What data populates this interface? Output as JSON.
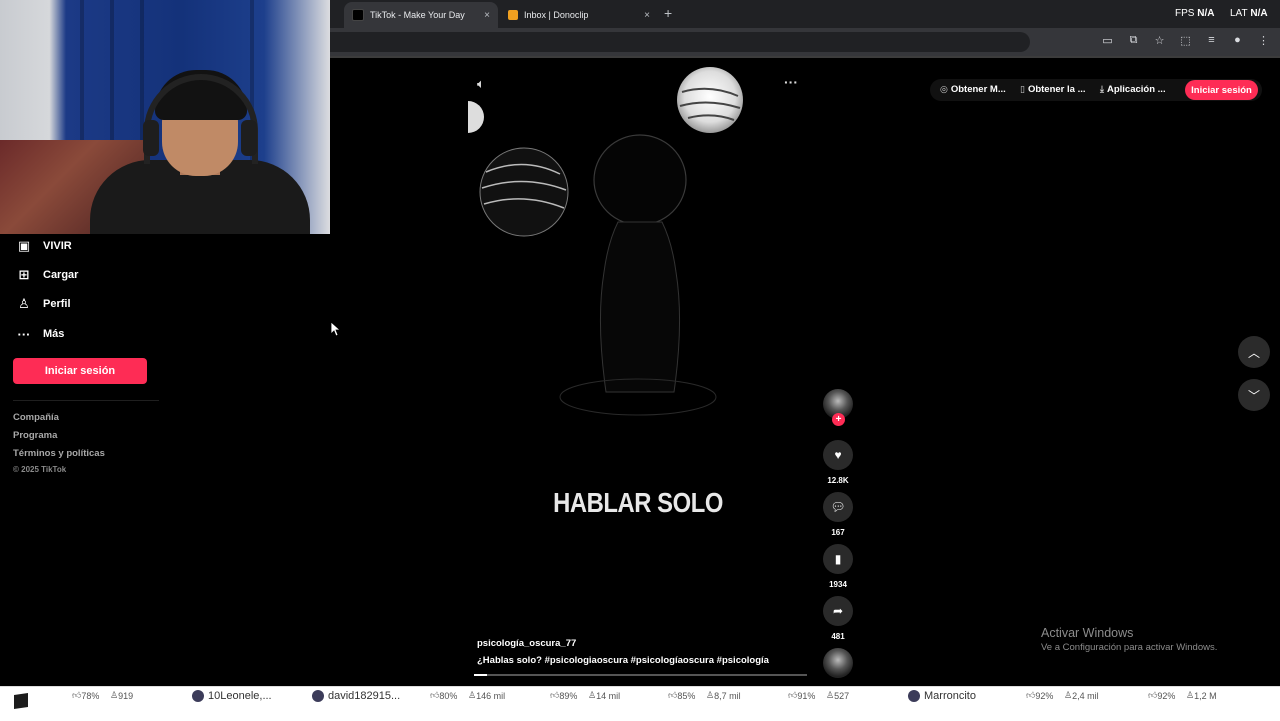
{
  "browser": {
    "tabs": [
      {
        "title": "TikTok - Make Your Day",
        "active": true
      },
      {
        "title": "Inbox | Donoclip",
        "active": false
      }
    ],
    "new_tab": "+",
    "tab_close": "×",
    "osd": {
      "fps_label": "FPS",
      "fps_value": "N/A",
      "lat_label": "LAT",
      "lat_value": "N/A"
    }
  },
  "sidebar": {
    "items": [
      {
        "label": "VIVIR",
        "icon": "live-icon"
      },
      {
        "label": "Cargar",
        "icon": "upload-icon"
      },
      {
        "label": "Perfil",
        "icon": "profile-icon"
      },
      {
        "label": "Más",
        "icon": "more-icon"
      }
    ],
    "login_label": "Iniciar sesión",
    "footer_links": [
      "Compañía",
      "Programa",
      "Términos y políticas"
    ],
    "copyright": "© 2025 TikTok"
  },
  "header": {
    "items": [
      {
        "label": "Obtener M...",
        "icon": "coin-icon"
      },
      {
        "label": "Obtener la ...",
        "icon": "phone-icon"
      },
      {
        "label": "Aplicación ...",
        "icon": "download-icon"
      }
    ],
    "login_label": "Iniciar sesión"
  },
  "video": {
    "title": "HABLAR SOLO",
    "username": "psicología_oscura_77",
    "description": "¿Hablas solo? #psicologiaoscura  #psicologíaoscura  #psicología",
    "progress": 0.04,
    "actions": {
      "likes": "12.8K",
      "comments": "167",
      "saves": "1934",
      "shares": "481"
    }
  },
  "watermark": {
    "line1": "Activar Windows",
    "line2": "Ve a Configuración para activar Windows."
  },
  "taskbar": {
    "items": [
      "78%",
      "919",
      "10Leonele,...",
      "david182915...",
      "80%",
      "146 mil",
      "89%",
      "14 mil",
      "85%",
      "8,7 mil",
      "91%",
      "527",
      "Marroncito",
      "92%",
      "2,4 mil",
      "92%",
      "1,2 M"
    ]
  }
}
